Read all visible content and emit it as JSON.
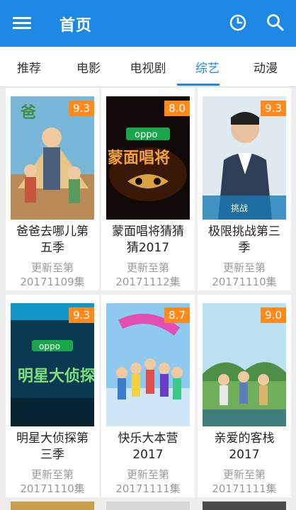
{
  "header": {
    "title": "首页",
    "menu_icon": "menu-icon",
    "history_icon": "clock-icon",
    "search_icon": "search-icon",
    "color": "#1e88e5"
  },
  "tabs": [
    {
      "label": "推荐"
    },
    {
      "label": "电影"
    },
    {
      "label": "电视剧"
    },
    {
      "label": "综艺",
      "active": true
    },
    {
      "label": "动漫"
    }
  ],
  "cards": [
    {
      "title_line1": "爸爸去哪儿第",
      "title_line2": "五季",
      "score": "9.3",
      "update_line1": "更新至第",
      "update_line2": "20171109集"
    },
    {
      "title_line1": "蒙面唱将猜猜",
      "title_line2": "猜2017",
      "score": "8.0",
      "update_line1": "更新至第",
      "update_line2": "20171112集"
    },
    {
      "title_line1": "极限挑战第三",
      "title_line2": "季",
      "score": "9.3",
      "update_line1": "更新至第",
      "update_line2": "20171110集"
    },
    {
      "title_line1": "明星大侦探第",
      "title_line2": "三季",
      "score": "9.3",
      "update_line1": "更新至第",
      "update_line2": "20171110集"
    },
    {
      "title_line1": "快乐大本营",
      "title_line2": "2017",
      "score": "8.7",
      "update_line1": "更新至第",
      "update_line2": "20171111集"
    },
    {
      "title_line1": "亲爱的客栈",
      "title_line2": "2017",
      "score": "9.0",
      "update_line1": "更新至第",
      "update_line2": "20171111集"
    }
  ]
}
